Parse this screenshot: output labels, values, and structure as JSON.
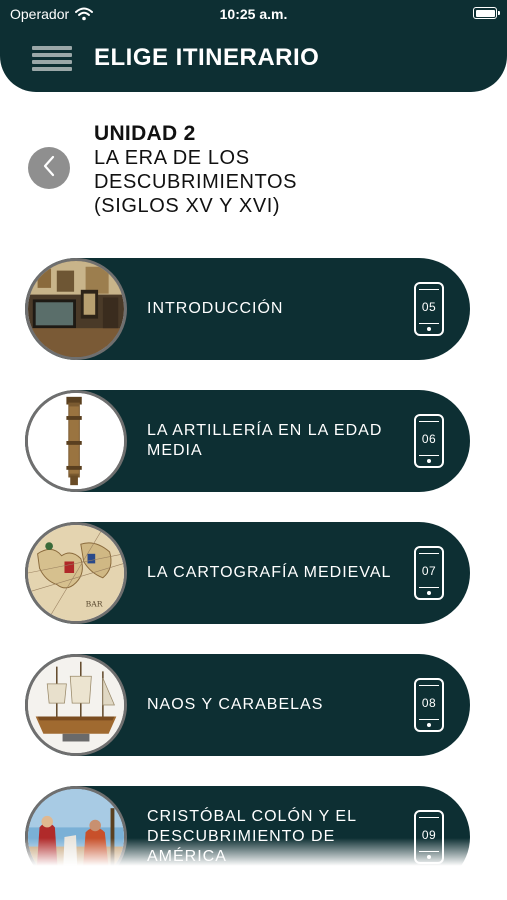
{
  "status_bar": {
    "carrier": "Operador",
    "time": "10:25 a.m."
  },
  "nav": {
    "title": "ELIGE ITINERARIO"
  },
  "unit": {
    "label": "UNIDAD 2",
    "title": "LA ERA DE LOS DESCUBRIMIENTOS (SIGLOS XV Y XVI)"
  },
  "items": [
    {
      "label": "INTRODUCCIÓN",
      "number": "05",
      "thumbnail": "museum-hall"
    },
    {
      "label": "LA ARTILLERÍA EN LA EDAD MEDIA",
      "number": "06",
      "thumbnail": "cannon"
    },
    {
      "label": "LA CARTOGRAFÍA MEDIEVAL",
      "number": "07",
      "thumbnail": "old-map"
    },
    {
      "label": "NAOS Y CARABELAS",
      "number": "08",
      "thumbnail": "caravel-model"
    },
    {
      "label": "CRISTÓBAL COLÓN Y EL DESCUBRIMIENTO DE AMÉRICA",
      "number": "09",
      "thumbnail": "columbus-painting"
    }
  ],
  "colors": {
    "primary": "#0d2f33",
    "back_button": "#8f8f8f",
    "menu_bars": "#9aa7a8"
  }
}
